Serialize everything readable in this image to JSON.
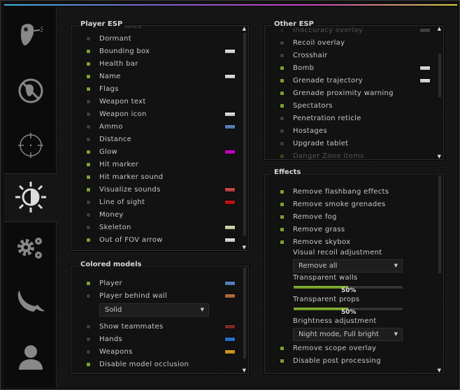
{
  "accent_gradient": [
    "#3bb4d8",
    "#7b5fd0",
    "#c93fc0",
    "#d8d040"
  ],
  "checkbox_on_color": "#7aa132",
  "sidebar": {
    "tabs": [
      {
        "icon": "rage-head-icon",
        "active": false
      },
      {
        "icon": "anti-aim-icon",
        "active": false
      },
      {
        "icon": "crosshair-icon",
        "active": false
      },
      {
        "icon": "visuals-sun-icon",
        "active": true
      },
      {
        "icon": "gears-icon",
        "active": false
      },
      {
        "icon": "knife-icon",
        "active": false
      },
      {
        "icon": "player-icon",
        "active": false
      }
    ]
  },
  "player_esp": {
    "title": "Player ESP",
    "items": [
      {
        "label": "Teammates",
        "on": false,
        "faded": true
      },
      {
        "label": "Dormant",
        "on": false
      },
      {
        "label": "Bounding box",
        "on": true,
        "color": "#e8e8e8"
      },
      {
        "label": "Health bar",
        "on": true
      },
      {
        "label": "Name",
        "on": true,
        "color": "#e8e8e8"
      },
      {
        "label": "Flags",
        "on": true
      },
      {
        "label": "Weapon text",
        "on": false
      },
      {
        "label": "Weapon icon",
        "on": false,
        "color": "#e8e8e8"
      },
      {
        "label": "Ammo",
        "on": false,
        "color": "#5b8ac4"
      },
      {
        "label": "Distance",
        "on": false
      },
      {
        "label": "Glow",
        "on": true,
        "color": "#d400d0"
      },
      {
        "label": "Hit marker",
        "on": true
      },
      {
        "label": "Hit marker sound",
        "on": true
      },
      {
        "label": "Visualize sounds",
        "on": true,
        "color": "#d04848"
      },
      {
        "label": "Line of sight",
        "on": false,
        "color": "#d01010"
      },
      {
        "label": "Money",
        "on": false
      },
      {
        "label": "Skeleton",
        "on": false,
        "color": "#e0e0b0"
      },
      {
        "label": "Out of FOV arrow",
        "on": true,
        "color": "#e8e8e8"
      }
    ]
  },
  "colored_models": {
    "title": "Colored models",
    "items": [
      {
        "label": "Player",
        "on": true,
        "color": "#5b8ac4"
      },
      {
        "label": "Player behind wall",
        "on": false,
        "color": "#c07040"
      },
      {
        "dropdown": "Solid"
      },
      {
        "label": "Show teammates",
        "on": false,
        "color": "#8a2a2a"
      },
      {
        "label": "Hands",
        "on": false,
        "color": "#2a78d8"
      },
      {
        "label": "Weapons",
        "on": false,
        "color": "#e0a020"
      },
      {
        "label": "Disable model occlusion",
        "on": true
      }
    ]
  },
  "other_esp": {
    "title": "Other ESP",
    "items": [
      {
        "label": "Inaccuracy overlay",
        "on": false,
        "color": "#a0a0a0",
        "faded": true
      },
      {
        "label": "Recoil overlay",
        "on": false
      },
      {
        "label": "Crosshair",
        "on": false
      },
      {
        "label": "Bomb",
        "on": true,
        "color": "#e8e8e8"
      },
      {
        "label": "Grenade trajectory",
        "on": true,
        "color": "#e8e8e8"
      },
      {
        "label": "Grenade proximity warning",
        "on": true
      },
      {
        "label": "Spectators",
        "on": true
      },
      {
        "label": "Penetration reticle",
        "on": false
      },
      {
        "label": "Hostages",
        "on": false
      },
      {
        "label": "Upgrade tablet",
        "on": false
      },
      {
        "label": "Danger Zone items",
        "on": true,
        "faded": true
      }
    ]
  },
  "effects": {
    "title": "Effects",
    "items": [
      {
        "label": "Remove flashbang effects",
        "on": true
      },
      {
        "label": "Remove smoke grenades",
        "on": true
      },
      {
        "label": "Remove fog",
        "on": true
      },
      {
        "label": "Remove grass",
        "on": true
      },
      {
        "label": "Remove skybox",
        "on": true
      },
      {
        "sublabel": "Visual recoil adjustment"
      },
      {
        "dropdown": "Remove all"
      },
      {
        "sublabel": "Transparent walls"
      },
      {
        "slider": 50,
        "text": "50%"
      },
      {
        "sublabel": "Transparent props"
      },
      {
        "slider": 50,
        "text": "50%"
      },
      {
        "sublabel": "Brightness adjustment"
      },
      {
        "dropdown": "Night mode, Full bright"
      },
      {
        "label": "Remove scope overlay",
        "on": true
      },
      {
        "label": "Disable post processing",
        "on": true
      }
    ]
  }
}
